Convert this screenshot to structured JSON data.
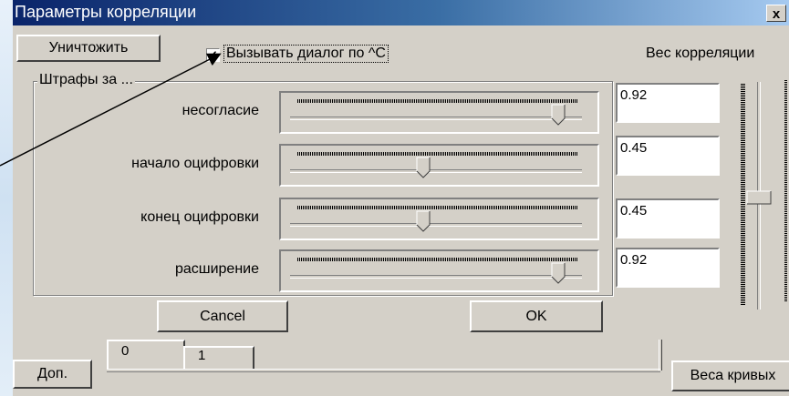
{
  "window": {
    "title": "Параметры корреляции",
    "close_glyph": "x"
  },
  "toolbar": {
    "destroy_label": "Уничтожить"
  },
  "checkbox": {
    "label": "Вызывать диалог по ^C",
    "checked_glyph": "✓",
    "checked": true
  },
  "weight": {
    "label": "Вес корреляции",
    "value_fraction": 0.54
  },
  "group": {
    "title": "Штрафы за ...",
    "rows": [
      {
        "label": "несогласие",
        "value": "0.92",
        "slider_fraction": 0.92
      },
      {
        "label": "начало оцифровки",
        "value": "0.45",
        "slider_fraction": 0.45
      },
      {
        "label": "конец оцифровки",
        "value": "0.45",
        "slider_fraction": 0.45
      },
      {
        "label": "расширение",
        "value": "0.92",
        "slider_fraction": 0.92
      }
    ]
  },
  "buttons": {
    "cancel": "Cancel",
    "ok": "OK",
    "extra": "Доп.",
    "curve_weights": "Веса кривых"
  },
  "tabs": [
    {
      "label": "0"
    },
    {
      "label": "1"
    }
  ],
  "colors": {
    "titlebar_start": "#0a246a",
    "titlebar_end": "#a6caf0",
    "dialog_bg": "#d4d0c8"
  }
}
